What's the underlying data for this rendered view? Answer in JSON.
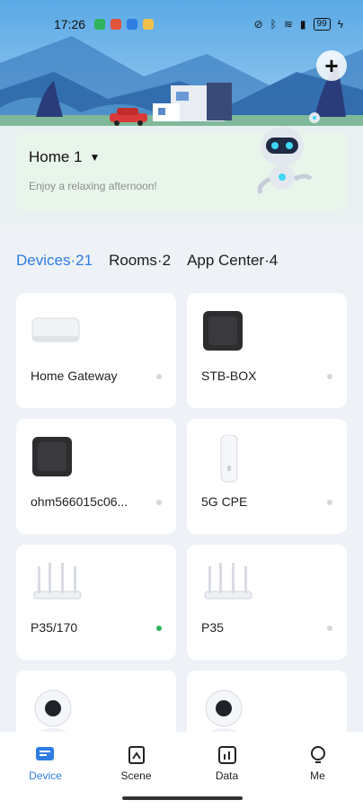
{
  "status_bar": {
    "time": "17:26",
    "battery": "99"
  },
  "header": {
    "add_icon": "plus-icon"
  },
  "home": {
    "title": "Home 1",
    "subtitle": "Enjoy a relaxing afternoon!"
  },
  "tabs": [
    {
      "label": "Devices",
      "count": "21",
      "active": true
    },
    {
      "label": "Rooms",
      "count": "2",
      "active": false
    },
    {
      "label": "App Center",
      "count": "4",
      "active": false
    }
  ],
  "devices": [
    {
      "name": "Home Gateway",
      "icon": "gateway-icon",
      "online": false
    },
    {
      "name": "STB-BOX",
      "icon": "stb-box-icon",
      "online": false
    },
    {
      "name": "ohm566015c06...",
      "icon": "box-icon",
      "online": false
    },
    {
      "name": "5G CPE",
      "icon": "cpe-icon",
      "online": false
    },
    {
      "name": "P35/170",
      "icon": "router-icon",
      "online": true
    },
    {
      "name": "P35",
      "icon": "router-icon",
      "online": false
    },
    {
      "name": "",
      "icon": "camera-icon",
      "online": false
    },
    {
      "name": "",
      "icon": "camera-icon",
      "online": false
    }
  ],
  "nav": [
    {
      "label": "Device",
      "icon": "device-icon",
      "active": true
    },
    {
      "label": "Scene",
      "icon": "scene-icon",
      "active": false
    },
    {
      "label": "Data",
      "icon": "data-icon",
      "active": false
    },
    {
      "label": "Me",
      "icon": "me-icon",
      "active": false
    }
  ],
  "colors": {
    "accent": "#2f7ce3",
    "online": "#2fb35b",
    "offline": "#d4d7dc"
  }
}
